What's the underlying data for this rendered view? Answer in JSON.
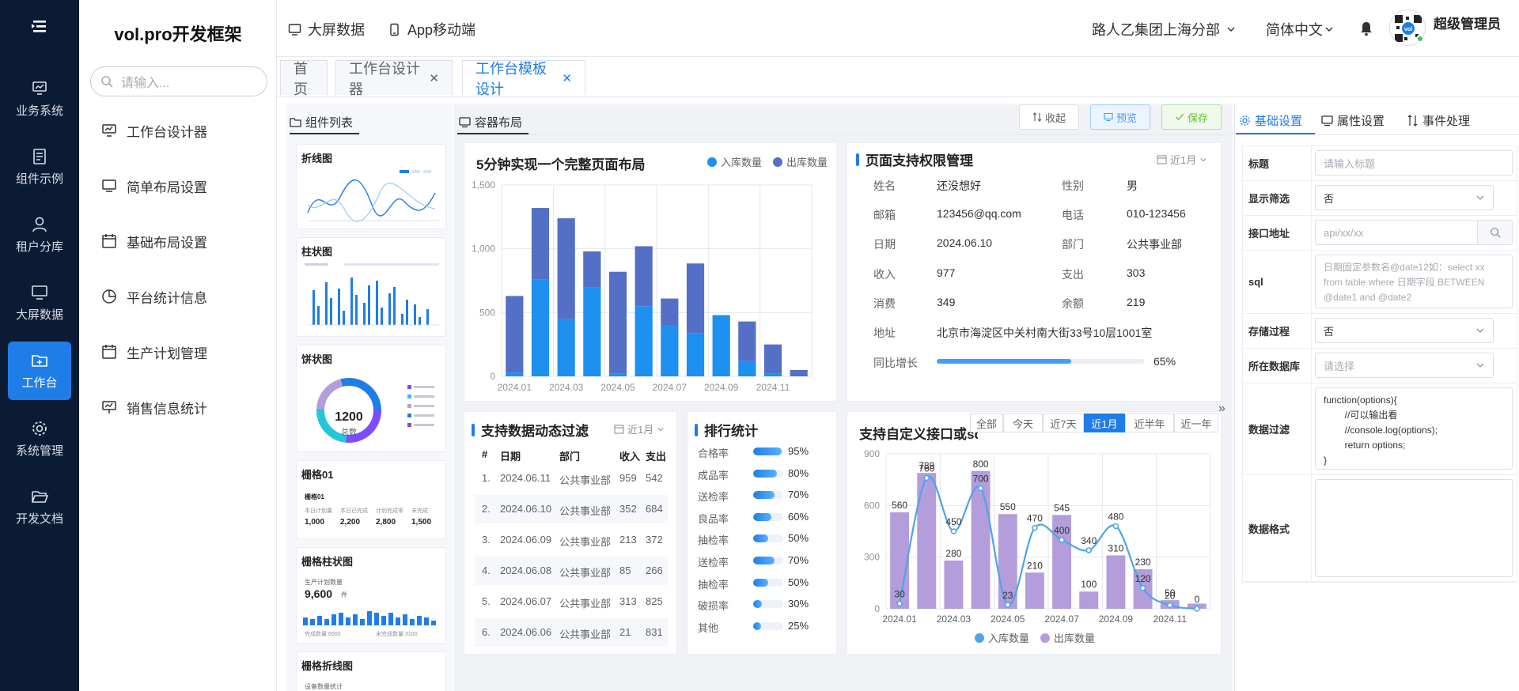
{
  "rail": [
    {
      "label": "业务系统",
      "icon": "monitor-chart-icon"
    },
    {
      "label": "组件示例",
      "icon": "document-list-icon"
    },
    {
      "label": "租户分库",
      "icon": "user-icon"
    },
    {
      "label": "大屏数据",
      "icon": "monitor-icon"
    },
    {
      "label": "工作台",
      "icon": "folder-plus-icon",
      "active": true
    },
    {
      "label": "系统管理",
      "icon": "gear-icon"
    },
    {
      "label": "开发文档",
      "icon": "folder-open-icon"
    }
  ],
  "menu": {
    "brand": "vol.pro开发框架",
    "search_placeholder": "请输入...",
    "items": [
      "工作台设计器",
      "简单布局设置",
      "基础布局设置",
      "平台统计信息",
      "生产计划管理",
      "销售信息统计"
    ]
  },
  "header": {
    "links": [
      "大屏数据",
      "App移动端"
    ],
    "org": "路人乙集团上海分部",
    "lang": "简体中文",
    "user": "超级管理员"
  },
  "tabs": [
    {
      "label": "首页"
    },
    {
      "label": "工作台设计器",
      "closable": true
    },
    {
      "label": "工作台模板设计",
      "closable": true,
      "active": true
    }
  ],
  "palette": {
    "title": "组件列表",
    "items": [
      "折线图",
      "柱状图",
      "饼状图",
      "栅格01",
      "栅格柱状图",
      "栅格折线图"
    ],
    "donut_value": "1200",
    "donut_label": "总数",
    "grid01_title": "栅格01",
    "grid01_labels": [
      "本日计划量",
      "本日已完成",
      "计划完成率",
      "未完成"
    ],
    "grid01_values": [
      "1,000",
      "2,200",
      "2,800",
      "1,500"
    ],
    "gridbar_label": "生产计划数量",
    "gridbar_value": "9,600",
    "gridbar_unit": "件",
    "gridbar_footer_left": "完成数量:6500",
    "gridbar_footer_right": "未完成数量:3100",
    "gridline_label": "设备数量统计"
  },
  "canvas": {
    "title": "容器布局",
    "btn_collapse": "收起",
    "btn_preview": "预览",
    "btn_save": "保存"
  },
  "card1": {
    "title": "5分钟实现一个完整页面布局",
    "legend": [
      "入库数量",
      "出库数量"
    ]
  },
  "card2": {
    "title": "页面支持权限管理",
    "period": "近1月",
    "fields": [
      {
        "k": "姓名",
        "v": "还没想好",
        "k2": "性别",
        "v2": "男"
      },
      {
        "k": "邮箱",
        "v": "123456@qq.com",
        "k2": "电话",
        "v2": "010-123456"
      },
      {
        "k": "日期",
        "v": "2024.06.10",
        "k2": "部门",
        "v2": "公共事业部"
      },
      {
        "k": "收入",
        "v": "977",
        "k2": "支出",
        "v2": "303"
      },
      {
        "k": "消费",
        "v": "349",
        "k2": "余额",
        "v2": "219"
      }
    ],
    "address_label": "地址",
    "address": "北京市海淀区中关村南大街33号10层1001室",
    "growth_label": "同比增长",
    "growth_value": 0.65,
    "growth_text": "65%"
  },
  "card3": {
    "title": "支持数据动态过滤",
    "period": "近1月",
    "headers": [
      "#",
      "日期",
      "部门",
      "收入",
      "支出"
    ],
    "rows": [
      [
        "1.",
        "2024.06.11",
        "公共事业部",
        "959",
        "542"
      ],
      [
        "2.",
        "2024.06.10",
        "公共事业部",
        "352",
        "684"
      ],
      [
        "3.",
        "2024.06.09",
        "公共事业部",
        "213",
        "372"
      ],
      [
        "4.",
        "2024.06.08",
        "公共事业部",
        "85",
        "266"
      ],
      [
        "5.",
        "2024.06.07",
        "公共事业部",
        "313",
        "825"
      ],
      [
        "6.",
        "2024.06.06",
        "公共事业部",
        "21",
        "831"
      ]
    ]
  },
  "card4": {
    "title": "排行统计",
    "items": [
      {
        "label": "合格率",
        "pct": 95,
        "text": "95%"
      },
      {
        "label": "成品率",
        "pct": 80,
        "text": "80%"
      },
      {
        "label": "送检率",
        "pct": 70,
        "text": "70%"
      },
      {
        "label": "良品率",
        "pct": 60,
        "text": "60%"
      },
      {
        "label": "抽检率",
        "pct": 50,
        "text": "50%"
      },
      {
        "label": "送检率",
        "pct": 70,
        "text": "70%"
      },
      {
        "label": "抽检率",
        "pct": 50,
        "text": "50%"
      },
      {
        "label": "破损率",
        "pct": 30,
        "text": "30%"
      },
      {
        "label": "其他",
        "pct": 25,
        "text": "25%"
      }
    ]
  },
  "card5": {
    "title": "支持自定义接口或sql",
    "filters": [
      "全部",
      "今天",
      "近7天",
      "近1月",
      "近半年",
      "近一年"
    ],
    "active_filter": "近1月",
    "legend": [
      "入库数量",
      "出库数量"
    ]
  },
  "props": {
    "tabs": [
      "基础设置",
      "属性设置",
      "事件处理"
    ],
    "rows": [
      {
        "label": "标题",
        "placeholder": "请输入标题"
      },
      {
        "label": "显示筛选",
        "value": "否"
      },
      {
        "label": "接口地址",
        "placeholder": "api/xx/xx"
      },
      {
        "label": "sql",
        "placeholder": "日期固定参数名@date12如：select xx from table where 日期字段 BETWEEN @date1 and @date2"
      },
      {
        "label": "存储过程",
        "value": "否"
      },
      {
        "label": "所在数据库",
        "placeholder": "请选择"
      },
      {
        "label": "数据过滤",
        "code": [
          "function(options){",
          "        //可以输出看",
          "        //console.log(options);",
          "        return options;",
          "}"
        ]
      },
      {
        "label": "数据格式",
        "value": ""
      }
    ]
  },
  "colors": {
    "accent": "#1f7de8",
    "dark_series": "#5470c6",
    "light_series": "#1e90f0",
    "purple": "#b39ddb",
    "line": "#4ea4e8",
    "rail_bg": "#0b1b34"
  },
  "chart_data": [
    {
      "type": "bar",
      "title": "5分钟实现一个完整页面布局",
      "stacked": true,
      "categories": [
        "2024.01",
        "2024.02",
        "2024.03",
        "2024.04",
        "2024.05",
        "2024.06",
        "2024.07",
        "2024.08",
        "2024.09",
        "2024.10",
        "2024.11",
        "2024.12"
      ],
      "x_tick_labels": [
        "2024.01",
        "2024.03",
        "2024.05",
        "2024.07",
        "2024.09",
        "2024.11"
      ],
      "series": [
        {
          "name": "入库数量",
          "values": [
            30,
            760,
            450,
            700,
            20,
            550,
            400,
            340,
            480,
            120,
            20,
            0
          ]
        },
        {
          "name": "出库数量",
          "values": [
            600,
            560,
            789,
            280,
            800,
            470,
            210,
            545,
            0,
            310,
            230,
            50
          ]
        }
      ],
      "ylim": [
        0,
        1500
      ],
      "yticks": [
        0,
        500,
        1000,
        1500
      ],
      "ytick_labels": [
        "0",
        "500",
        "1,000",
        "1,500"
      ],
      "grid": true,
      "legend": "top-right"
    },
    {
      "type": "bar+line",
      "title": "支持自定义接口或sql",
      "categories": [
        "2024.01",
        "2024.02",
        "2024.03",
        "2024.04",
        "2024.05",
        "2024.06",
        "2024.07",
        "2024.08",
        "2024.09",
        "2024.10",
        "2024.11",
        "2024.12"
      ],
      "x_tick_labels": [
        "2024.01",
        "2024.03",
        "2024.05",
        "2024.07",
        "2024.09",
        "2024.11"
      ],
      "series": [
        {
          "name": "入库数量",
          "type": "line",
          "values": [
            30,
            760,
            450,
            700,
            23,
            470,
            400,
            340,
            480,
            120,
            20,
            0
          ],
          "labels": [
            "30",
            "760",
            "450",
            "700",
            "23",
            "470",
            "400",
            "340",
            "480",
            "120",
            "20",
            "0"
          ]
        },
        {
          "name": "出库数量",
          "type": "bar",
          "values": [
            560,
            789,
            280,
            800,
            550,
            210,
            545,
            100,
            310,
            230,
            50,
            30
          ],
          "labels": [
            "560",
            "789",
            "280",
            "800",
            "550",
            "210",
            "545",
            "100",
            "310",
            "230",
            "50",
            ""
          ]
        }
      ],
      "ylim": [
        0,
        900
      ],
      "yticks": [
        0,
        300,
        600,
        900
      ],
      "grid": true,
      "legend": "bottom"
    }
  ]
}
